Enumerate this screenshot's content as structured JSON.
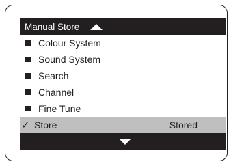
{
  "menu": {
    "title": "Manual Store",
    "items": [
      {
        "label": "Colour System"
      },
      {
        "label": "Sound System"
      },
      {
        "label": "Search"
      },
      {
        "label": "Channel"
      },
      {
        "label": "Fine Tune"
      }
    ],
    "selected": {
      "check": "✓",
      "label": "Store",
      "value": "Stored"
    }
  }
}
